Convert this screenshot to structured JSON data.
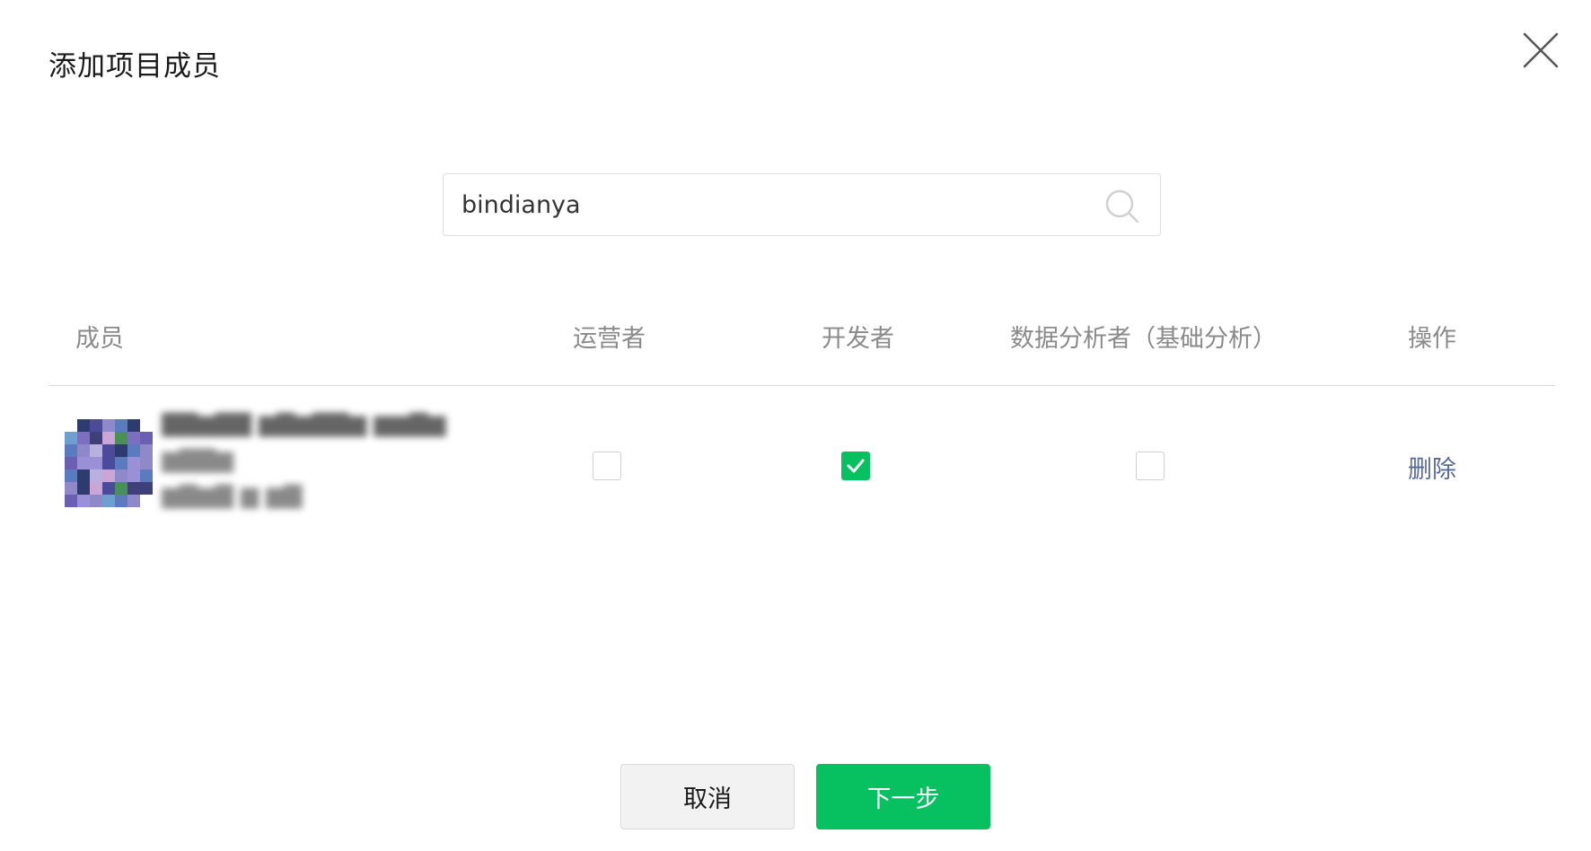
{
  "dialog": {
    "title": "添加项目成员"
  },
  "search": {
    "value": "bindianya"
  },
  "table": {
    "headers": {
      "member": "成员",
      "operator": "运营者",
      "developer": "开发者",
      "analyst": "数据分析者（基础分析）",
      "action": "操作"
    },
    "rows": [
      {
        "roles": {
          "operator": false,
          "developer": true,
          "analyst": false
        },
        "action_label": "删除"
      }
    ]
  },
  "footer": {
    "cancel_label": "取消",
    "next_label": "下一步"
  },
  "colors": {
    "accent": "#07c160",
    "link": "#576b95"
  },
  "icons": {
    "close": "close-icon",
    "search": "search-icon",
    "check": "check-icon"
  }
}
